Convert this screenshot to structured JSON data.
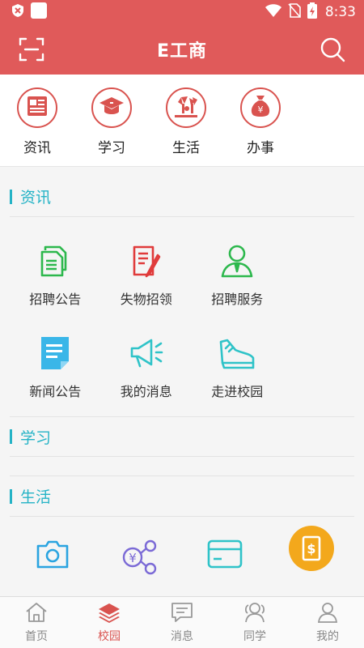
{
  "status_bar": {
    "time": "8:33"
  },
  "header": {
    "title": "E工商"
  },
  "top_categories": [
    {
      "label": "资讯",
      "icon": "news-icon"
    },
    {
      "label": "学习",
      "icon": "graduation-cap-icon"
    },
    {
      "label": "生活",
      "icon": "life-icon"
    },
    {
      "label": "办事",
      "icon": "money-bag-icon"
    }
  ],
  "sections": {
    "news": {
      "title": "资讯",
      "items": [
        {
          "label": "招聘公告",
          "icon": "documents-icon",
          "color": "#2db84d"
        },
        {
          "label": "失物招领",
          "icon": "notepad-pen-icon",
          "color": "#e03b3b"
        },
        {
          "label": "招聘服务",
          "icon": "person-icon",
          "color": "#2db84d"
        },
        {
          "label": "新闻公告",
          "icon": "note-icon",
          "color": "#3ab6e8"
        },
        {
          "label": "我的消息",
          "icon": "megaphone-icon",
          "color": "#2fc3c8"
        },
        {
          "label": "走进校园",
          "icon": "sneaker-icon",
          "color": "#2fc3c8"
        }
      ]
    },
    "study": {
      "title": "学习"
    },
    "life": {
      "title": "生活",
      "items": [
        {
          "icon": "camera-icon",
          "color": "#2aa4e0"
        },
        {
          "icon": "yuan-network-icon",
          "color": "#7b6ad6"
        },
        {
          "icon": "card-icon",
          "color": "#2fc3c8"
        },
        {
          "icon": "dollar-badge-icon",
          "color": "#f3a81c"
        }
      ]
    }
  },
  "bottom_nav": [
    {
      "label": "首页",
      "icon": "home-icon"
    },
    {
      "label": "校园",
      "icon": "layers-icon",
      "active": true
    },
    {
      "label": "消息",
      "icon": "message-icon"
    },
    {
      "label": "同学",
      "icon": "classmates-icon"
    },
    {
      "label": "我的",
      "icon": "profile-icon"
    }
  ],
  "colors": {
    "brand": "#e05a5a",
    "accent": "#25b3c6",
    "active_tab": "#d9534f"
  }
}
